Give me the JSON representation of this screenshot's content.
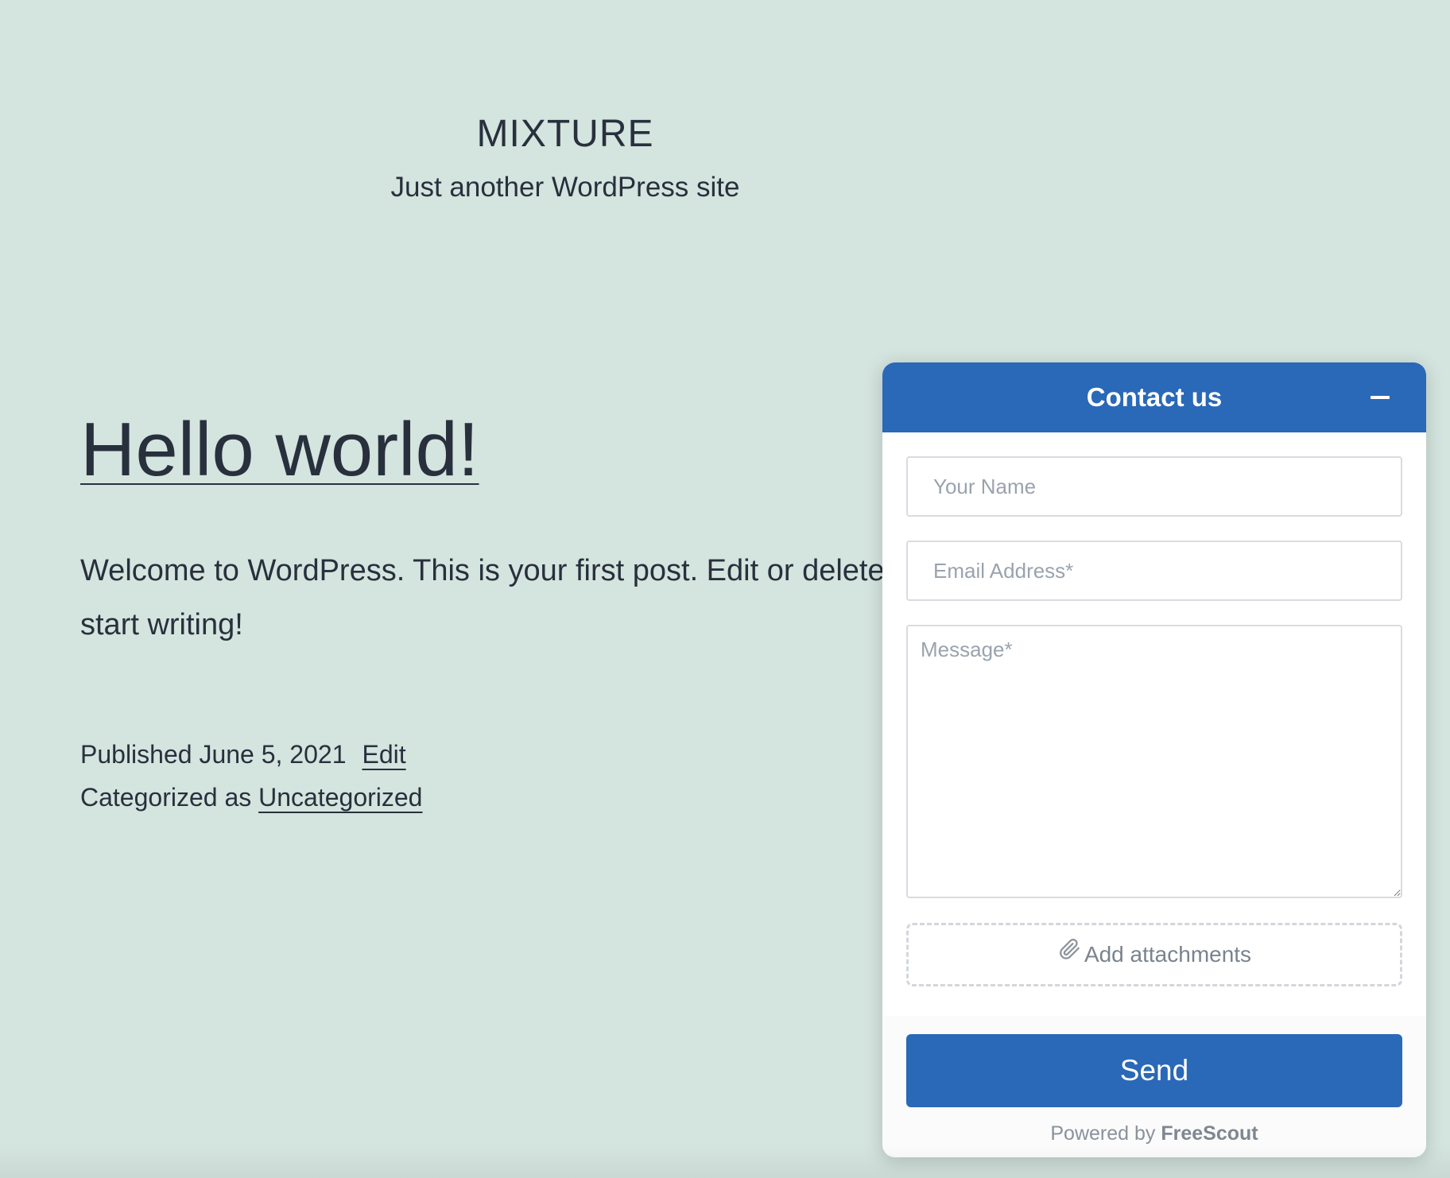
{
  "site": {
    "title": "MIXTURE",
    "tagline": "Just another WordPress site"
  },
  "post": {
    "title": "Hello world!",
    "content_line_1": "Welcome to WordPress. This is your first post. Edit or delete",
    "content_line_2": "start writing!",
    "published_label": "Published",
    "published_date": "June 5, 2021",
    "edit_label": "Edit",
    "categorized_label": "Categorized as",
    "category": "Uncategorized"
  },
  "widget": {
    "title": "Contact us",
    "name_placeholder": "Your Name",
    "email_placeholder": "Email Address*",
    "message_placeholder": "Message*",
    "attach_label": "Add attachments",
    "send_label": "Send",
    "powered_prefix": "Powered by",
    "powered_brand": "FreeScout"
  },
  "colors": {
    "page_background": "#d4e4de",
    "accent": "#2a68b8",
    "text": "#28303d"
  },
  "icons": {
    "minimize": "minimize-icon",
    "attachment": "paperclip-icon"
  }
}
